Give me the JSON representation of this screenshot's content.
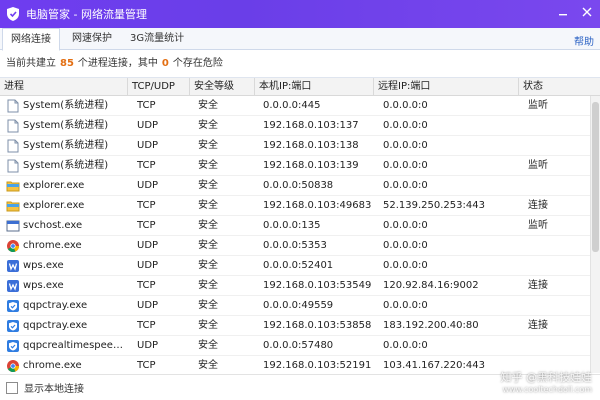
{
  "window": {
    "title": "电脑管家 - 网络流量管理",
    "logo_icon": "shield-icon",
    "controls": [
      "minimize",
      "close"
    ]
  },
  "tabs": [
    {
      "label": "网络连接",
      "active": true
    },
    {
      "label": "网速保护",
      "active": false
    },
    {
      "label": "3G流量统计",
      "active": false
    }
  ],
  "help_label": "帮助",
  "summary": {
    "prefix": "当前共建立",
    "count": "85",
    "middle": "个进程连接，其中",
    "danger": "0",
    "suffix": "个存在危险"
  },
  "columns": [
    "进程",
    "TCP/UDP",
    "安全等级",
    "本机IP:端口",
    "远程IP:端口",
    "状态"
  ],
  "rows": [
    {
      "icon": "document-icon",
      "process": "System(系统进程)",
      "protocol": "TCP",
      "level": "安全",
      "local": "0.0.0.0:445",
      "remote": "0.0.0.0:0",
      "state": "监听"
    },
    {
      "icon": "document-icon",
      "process": "System(系统进程)",
      "protocol": "UDP",
      "level": "安全",
      "local": "192.168.0.103:137",
      "remote": "0.0.0.0:0",
      "state": ""
    },
    {
      "icon": "document-icon",
      "process": "System(系统进程)",
      "protocol": "UDP",
      "level": "安全",
      "local": "192.168.0.103:138",
      "remote": "0.0.0.0:0",
      "state": ""
    },
    {
      "icon": "document-icon",
      "process": "System(系统进程)",
      "protocol": "TCP",
      "level": "安全",
      "local": "192.168.0.103:139",
      "remote": "0.0.0.0:0",
      "state": "监听"
    },
    {
      "icon": "folder-icon",
      "process": "explorer.exe",
      "protocol": "UDP",
      "level": "安全",
      "local": "0.0.0.0:50838",
      "remote": "0.0.0.0:0",
      "state": ""
    },
    {
      "icon": "folder-icon",
      "process": "explorer.exe",
      "protocol": "TCP",
      "level": "安全",
      "local": "192.168.0.103:49683",
      "remote": "52.139.250.253:443",
      "state": "连接"
    },
    {
      "icon": "svchost-icon",
      "process": "svchost.exe",
      "protocol": "TCP",
      "level": "安全",
      "local": "0.0.0.0:135",
      "remote": "0.0.0.0:0",
      "state": "监听"
    },
    {
      "icon": "chrome-icon",
      "process": "chrome.exe",
      "protocol": "UDP",
      "level": "安全",
      "local": "0.0.0.0:5353",
      "remote": "0.0.0.0:0",
      "state": ""
    },
    {
      "icon": "wps-icon",
      "process": "wps.exe",
      "protocol": "UDP",
      "level": "安全",
      "local": "0.0.0.0:52401",
      "remote": "0.0.0.0:0",
      "state": ""
    },
    {
      "icon": "wps-icon",
      "process": "wps.exe",
      "protocol": "TCP",
      "level": "安全",
      "local": "192.168.0.103:53549",
      "remote": "120.92.84.16:9002",
      "state": "连接"
    },
    {
      "icon": "qq-shield-icon",
      "process": "qqpctray.exe",
      "protocol": "UDP",
      "level": "安全",
      "local": "0.0.0.0:49559",
      "remote": "0.0.0.0:0",
      "state": ""
    },
    {
      "icon": "qq-shield-icon",
      "process": "qqpctray.exe",
      "protocol": "TCP",
      "level": "安全",
      "local": "192.168.0.103:53858",
      "remote": "183.192.200.40:80",
      "state": "连接"
    },
    {
      "icon": "qq-shield-icon",
      "process": "qqpcrealtimespeedu...",
      "protocol": "UDP",
      "level": "安全",
      "local": "0.0.0.0:57480",
      "remote": "0.0.0.0:0",
      "state": ""
    },
    {
      "icon": "chrome-icon",
      "process": "chrome.exe",
      "protocol": "TCP",
      "level": "安全",
      "local": "192.168.0.103:52191",
      "remote": "103.41.167.220:443",
      "state": ""
    }
  ],
  "footer": {
    "checkbox_label": "显示本地连接",
    "checked": false
  },
  "watermark": {
    "text": "知乎 @黑科技娃娃",
    "url": "www.cooltechdoll.com"
  },
  "colors": {
    "titlebar": "#6f3df0",
    "count_highlight": "#e36f13",
    "link": "#2b62c4"
  }
}
